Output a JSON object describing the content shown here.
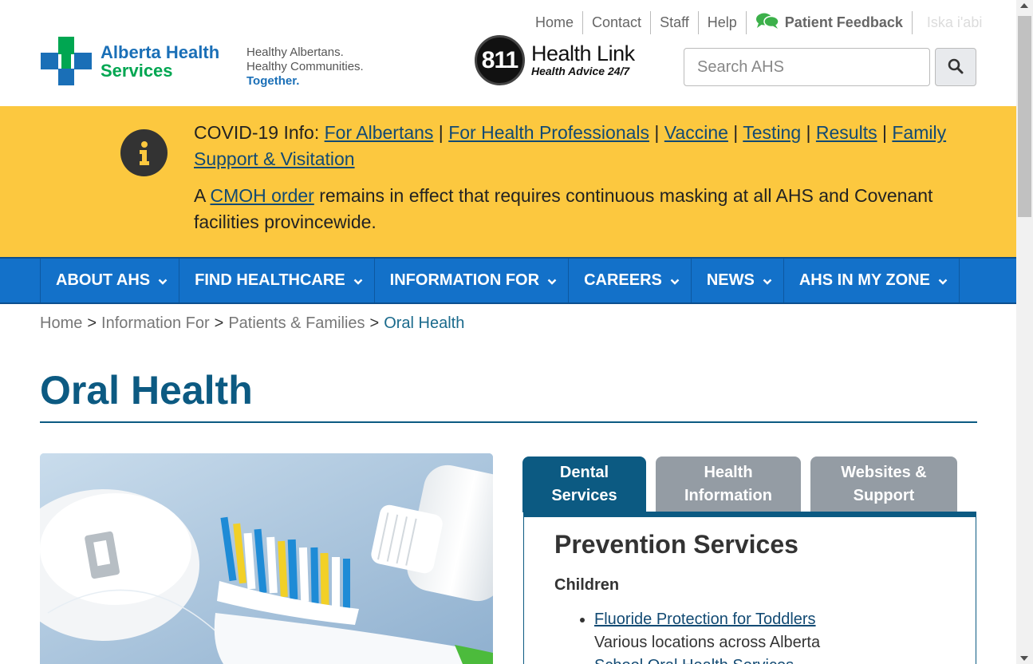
{
  "utility_nav": {
    "items": [
      "Home",
      "Contact",
      "Staff",
      "Help"
    ],
    "feedback": "Patient Feedback",
    "language": "Iska i'abi"
  },
  "logo": {
    "line1": "Alberta Health",
    "line2": "Services",
    "colors": {
      "blue": "#1a6fb7",
      "green": "#00a651"
    }
  },
  "tagline": {
    "line1": "Healthy Albertans.",
    "line2": "Healthy Communities.",
    "line3": "Together."
  },
  "health_link": {
    "number": "811",
    "title": "Health Link",
    "subtitle": "Health Advice 24/7"
  },
  "search": {
    "placeholder": "Search AHS",
    "icon": "search-icon"
  },
  "banner": {
    "background": "#fcc83f",
    "icon": "info-icon",
    "lead": "COVID-19 Info: ",
    "links": [
      "For Albertans",
      "For Health Professionals",
      "Vaccine",
      "Testing",
      "Results",
      "Family Support & Visitation"
    ],
    "separator": " | ",
    "p2_prefix": "A ",
    "p2_link": "CMOH order",
    "p2_suffix": " remains in effect that requires continuous masking at all AHS and Covenant facilities provincewide."
  },
  "main_nav": {
    "background": "#1371c9",
    "items": [
      "ABOUT AHS",
      "FIND HEALTHCARE",
      "INFORMATION FOR",
      "CAREERS",
      "NEWS",
      "AHS IN MY ZONE"
    ]
  },
  "breadcrumb": {
    "items": [
      "Home",
      "Information For",
      "Patients & Families"
    ],
    "separator": ">",
    "current": "Oral Health"
  },
  "page": {
    "title": "Oral Health",
    "accent": "#0c5a82"
  },
  "tabs": [
    {
      "line1": "Dental",
      "line2": "Services",
      "active": true
    },
    {
      "line1": "Health",
      "line2": "Information",
      "active": false
    },
    {
      "line1": "Websites &",
      "line2": "Support",
      "active": false
    }
  ],
  "panel": {
    "heading": "Prevention Services",
    "subheading": "Children",
    "items": [
      {
        "link": "Fluoride Protection for Toddlers",
        "desc": "Various locations across Alberta"
      },
      {
        "link": "School Oral Health Services",
        "desc": ""
      }
    ]
  }
}
